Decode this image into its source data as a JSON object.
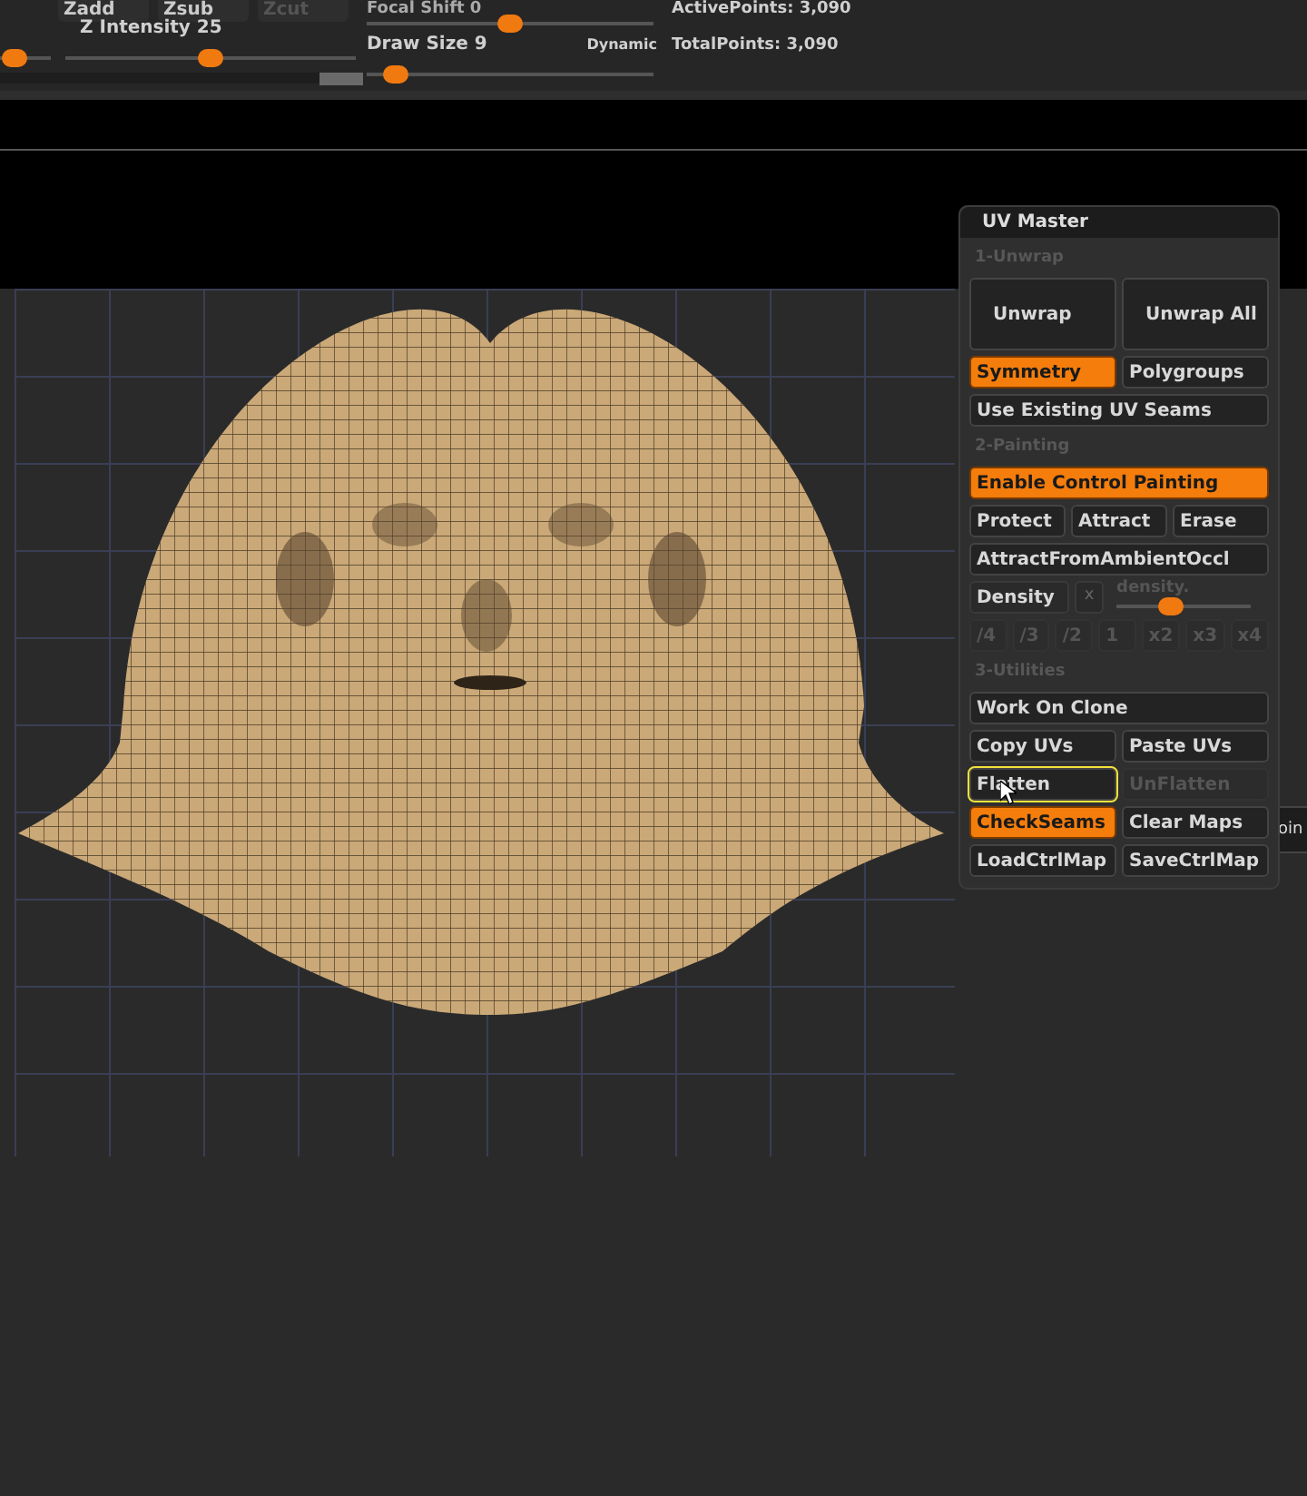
{
  "toolbar": {
    "buttons": [
      {
        "label": "Zadd",
        "disabled": false
      },
      {
        "label": "Zsub",
        "disabled": false
      },
      {
        "label": "Zcut",
        "disabled": true
      }
    ],
    "left_slider": {
      "level": 0.28
    },
    "sliders": [
      {
        "label": "Z Intensity 25",
        "level": 0.5
      },
      {
        "label": "Focal Shift 0",
        "level": 0.5
      },
      {
        "label": "Draw Size 9",
        "level": 0.1,
        "tag": "Dynamic"
      }
    ],
    "stats": [
      "ActivePoints: 3,090",
      "TotalPoints: 3,090"
    ]
  },
  "side_fragment": "oin",
  "panel": {
    "title": "UV Master",
    "sections": [
      {
        "heading": "1-Unwrap",
        "rows": [
          {
            "kind": "buttons",
            "tall": true,
            "buttons": [
              {
                "label": "Unwrap",
                "on": false,
                "disabled": false,
                "hovered": false
              },
              {
                "label": "Unwrap All",
                "on": false,
                "disabled": false,
                "hovered": false
              }
            ]
          },
          {
            "kind": "buttons",
            "buttons": [
              {
                "label": "Symmetry",
                "on": true,
                "disabled": false,
                "hovered": false
              },
              {
                "label": "Polygroups",
                "on": false,
                "disabled": false,
                "hovered": false
              }
            ]
          },
          {
            "kind": "buttons",
            "buttons": [
              {
                "label": "Use Existing UV Seams",
                "on": false,
                "disabled": false,
                "hovered": false
              }
            ]
          }
        ]
      },
      {
        "heading": "2-Painting",
        "rows": [
          {
            "kind": "buttons",
            "buttons": [
              {
                "label": "Enable Control Painting",
                "on": true,
                "disabled": false,
                "hovered": false
              }
            ]
          },
          {
            "kind": "buttons",
            "buttons": [
              {
                "label": "Protect",
                "on": false,
                "disabled": false,
                "hovered": false
              },
              {
                "label": "Attract",
                "on": false,
                "disabled": false,
                "hovered": false
              },
              {
                "label": "Erase",
                "on": false,
                "disabled": false,
                "hovered": false
              }
            ]
          },
          {
            "kind": "buttons",
            "buttons": [
              {
                "label": "AttractFromAmbientOccl",
                "on": false,
                "disabled": false,
                "hovered": false
              }
            ]
          },
          {
            "kind": "density",
            "button": "Density",
            "small": "x",
            "slider_label": "density.",
            "level": 0.4
          },
          {
            "kind": "buttons",
            "buttons": [
              {
                "label": "/4",
                "on": false,
                "disabled": true,
                "hovered": false
              },
              {
                "label": "/3",
                "on": false,
                "disabled": true,
                "hovered": false
              },
              {
                "label": "/2",
                "on": false,
                "disabled": true,
                "hovered": false
              },
              {
                "label": "1",
                "on": false,
                "disabled": true,
                "hovered": false
              },
              {
                "label": "x2",
                "on": false,
                "disabled": true,
                "hovered": false
              },
              {
                "label": "x3",
                "on": false,
                "disabled": true,
                "hovered": false
              },
              {
                "label": "x4",
                "on": false,
                "disabled": true,
                "hovered": false
              }
            ]
          }
        ]
      },
      {
        "heading": "3-Utilities",
        "rows": [
          {
            "kind": "buttons",
            "buttons": [
              {
                "label": "Work On Clone",
                "on": false,
                "disabled": false,
                "hovered": false
              }
            ]
          },
          {
            "kind": "buttons",
            "buttons": [
              {
                "label": "Copy UVs",
                "on": false,
                "disabled": false,
                "hovered": false
              },
              {
                "label": "Paste UVs",
                "on": false,
                "disabled": false,
                "hovered": false
              }
            ]
          },
          {
            "kind": "buttons",
            "buttons": [
              {
                "label": "Flatten",
                "on": false,
                "disabled": false,
                "hovered": true
              },
              {
                "label": "UnFlatten",
                "on": false,
                "disabled": true,
                "hovered": false
              }
            ]
          },
          {
            "kind": "buttons",
            "buttons": [
              {
                "label": "CheckSeams",
                "on": true,
                "disabled": false,
                "hovered": false
              },
              {
                "label": "Clear Maps",
                "on": false,
                "disabled": false,
                "hovered": false
              }
            ]
          },
          {
            "kind": "buttons",
            "buttons": [
              {
                "label": "LoadCtrlMap",
                "on": false,
                "disabled": false,
                "hovered": false
              },
              {
                "label": "SaveCtrlMap",
                "on": false,
                "disabled": false,
                "hovered": false
              }
            ]
          }
        ]
      }
    ]
  }
}
